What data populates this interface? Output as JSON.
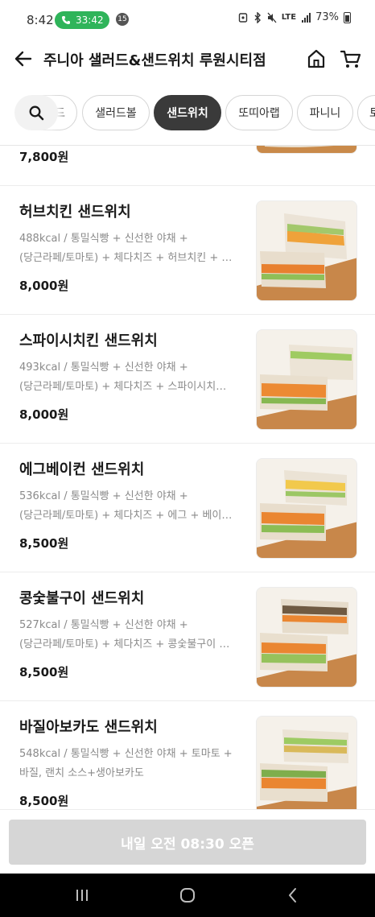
{
  "status_bar": {
    "time": "8:42",
    "call_duration": "33:42",
    "notification_count": "15",
    "network": "LTE",
    "battery": "73%"
  },
  "header": {
    "title": "주니아 샐러드&샌드위치 루원시티점"
  },
  "tabs": {
    "items": [
      {
        "label": "드",
        "active": false
      },
      {
        "label": "샐러드볼",
        "active": false
      },
      {
        "label": "샌드위치",
        "active": true
      },
      {
        "label": "또띠아랩",
        "active": false
      },
      {
        "label": "파니니",
        "active": false
      },
      {
        "label": "토",
        "active": false
      }
    ]
  },
  "menu": {
    "partial_item": {
      "price": "7,800원"
    },
    "items": [
      {
        "name": "허브치킨 샌드위치",
        "desc_line1": "488kcal / 통밀식빵 + 신선한 야채 +",
        "desc_line2": "(당근라페/토마토) + 체다치즈 + 허브치킨 + …",
        "price": "8,000원"
      },
      {
        "name": "스파이시치킨 샌드위치",
        "desc_line1": "493kcal / 통밀식빵 + 신선한 야채 +",
        "desc_line2": "(당근라페/토마토) + 체다치즈 + 스파이시치…",
        "price": "8,000원"
      },
      {
        "name": "에그베이컨 샌드위치",
        "desc_line1": "536kcal / 통밀식빵 + 신선한 야채 +",
        "desc_line2": "(당근라페/토마토) + 체다치즈 + 에그 + 베이…",
        "price": "8,500원"
      },
      {
        "name": "콩숯불구이 샌드위치",
        "desc_line1": "527kcal / 통밀식빵 + 신선한 야채 +",
        "desc_line2": "(당근라페/토마토) + 체다치즈 + 콩숯불구이 …",
        "price": "8,500원"
      },
      {
        "name": "바질아보카도 샌드위치",
        "desc_line1": "548kcal / 통밀식빵 + 신선한 야채 + 토마토 +",
        "desc_line2": "바질, 랜치 소스+생아보카도",
        "price": "8,500원"
      }
    ]
  },
  "open_button": {
    "label": "내일 오전 08:30 오픈"
  },
  "colors": {
    "call_green": "#2fb45a",
    "active_tab": "#3a3a3a",
    "disabled_button": "#d6d6d6",
    "desc_gray": "#8a8a8a"
  },
  "icons": [
    "back-arrow-icon",
    "home-icon",
    "cart-icon",
    "search-icon",
    "phone-icon",
    "recent-apps-icon",
    "home-circle-icon",
    "back-chevron-icon"
  ]
}
